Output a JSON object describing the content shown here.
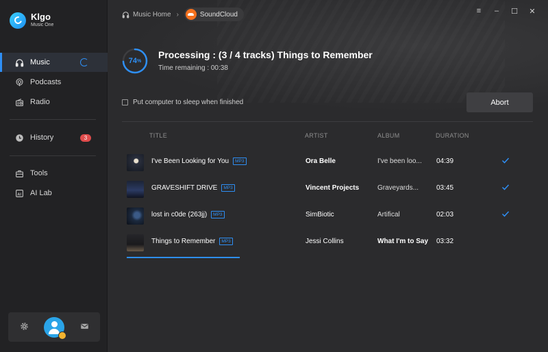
{
  "brand": {
    "name": "Klgo",
    "subtitle": "Music One"
  },
  "sidebar": {
    "items": [
      {
        "label": "Music",
        "icon": "headphones-icon",
        "active": true
      },
      {
        "label": "Podcasts",
        "icon": "podcast-icon"
      },
      {
        "label": "Radio",
        "icon": "radio-icon"
      },
      {
        "label": "History",
        "icon": "clock-icon",
        "badge": "3"
      },
      {
        "label": "Tools",
        "icon": "toolbox-icon"
      },
      {
        "label": "AI Lab",
        "icon": "ai-icon"
      }
    ],
    "bottom": {
      "settings_icon": "gear-icon",
      "avatar_icon": "user-avatar-icon",
      "mail_icon": "mail-icon"
    }
  },
  "breadcrumb": {
    "home": "Music Home",
    "source": "SoundCloud"
  },
  "window_controls": [
    "menu-icon",
    "minimize-icon",
    "maximize-icon",
    "close-icon"
  ],
  "processing": {
    "percent": 74,
    "percent_label": "74",
    "title": "Processing : (3 / 4 tracks) Things to Remember",
    "time_remaining": "Time remaining : 00:38"
  },
  "options": {
    "sleep_label": "Put computer to sleep when finished",
    "sleep_checked": false
  },
  "abort_label": "Abort",
  "table": {
    "headers": {
      "title": "TITLE",
      "artist": "ARTIST",
      "album": "ALBUM",
      "duration": "DURATION"
    },
    "rows": [
      {
        "title": "I've Been Looking for You",
        "format": "MP3",
        "artist": "Ora Belle",
        "album": "I've been loo...",
        "duration": "04:39",
        "done": true
      },
      {
        "title": "GRAVESHIFT DRIVE",
        "format": "MP3",
        "artist": "Vincent Projects",
        "album": "Graveyards...",
        "duration": "03:45",
        "done": true
      },
      {
        "title": "lost in c0de (263jj)",
        "format": "MP3",
        "artist": "SimBiotic",
        "album": "Artifical",
        "duration": "02:03",
        "done": true
      },
      {
        "title": "Things to Remember",
        "format": "MP3",
        "artist": "Jessi Collins",
        "album": "What I'm to Say",
        "duration": "03:32",
        "done": false
      }
    ]
  },
  "colors": {
    "accent": "#2e8ff5",
    "badge": "#e04c4c",
    "background": "#2b2b2d",
    "sidebar": "#222224"
  }
}
